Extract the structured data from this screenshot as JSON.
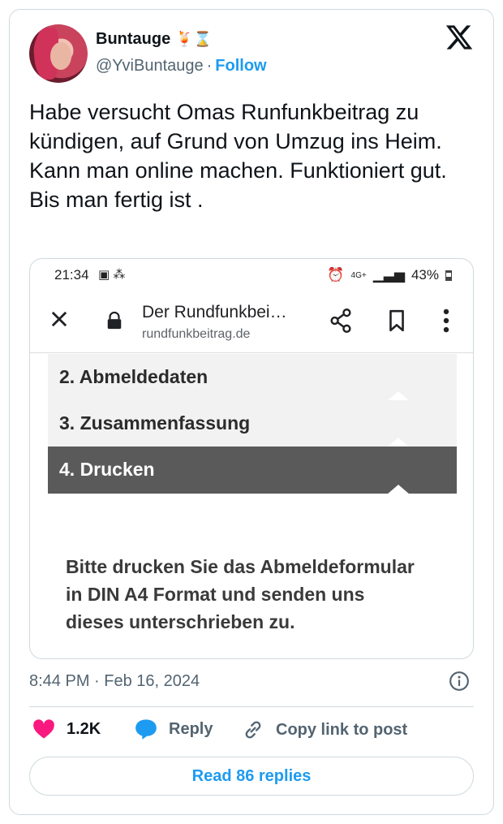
{
  "author": {
    "name": "Buntauge",
    "emoji": "🍹⌛",
    "handle": "@YviBuntauge",
    "separator": "·",
    "follow_label": "Follow"
  },
  "tweet": {
    "text": "Habe versucht Omas Runfunkbeitrag zu kündigen, auf Grund von Umzug ins Heim.\nKann man online machen. Funktioniert gut. Bis man fertig ist ."
  },
  "screenshot": {
    "status_bar": {
      "time": "21:34",
      "battery": "43%",
      "network": "4G+"
    },
    "browser": {
      "page_title": "Der Rundfunkbei…",
      "url": "rundfunkbeitrag.de"
    },
    "steps": [
      {
        "label": "2. Abmeldedaten"
      },
      {
        "label": "3. Zusammenfassung"
      },
      {
        "label": "4. Drucken",
        "active": true
      }
    ],
    "info_text": "Bitte drucken Sie das Abmeldeformular\nin DIN A4 Format und senden uns\ndieses unterschrieben zu."
  },
  "meta": {
    "timestamp": "8:44 PM · Feb 16, 2024"
  },
  "actions": {
    "like_count": "1.2K",
    "reply_label": "Reply",
    "copy_label": "Copy link to post"
  },
  "read_replies_label": "Read 86 replies",
  "colors": {
    "accent": "#1d9bf0",
    "like": "#f91880",
    "muted": "#536471",
    "active_step": "#5a5a5a"
  }
}
